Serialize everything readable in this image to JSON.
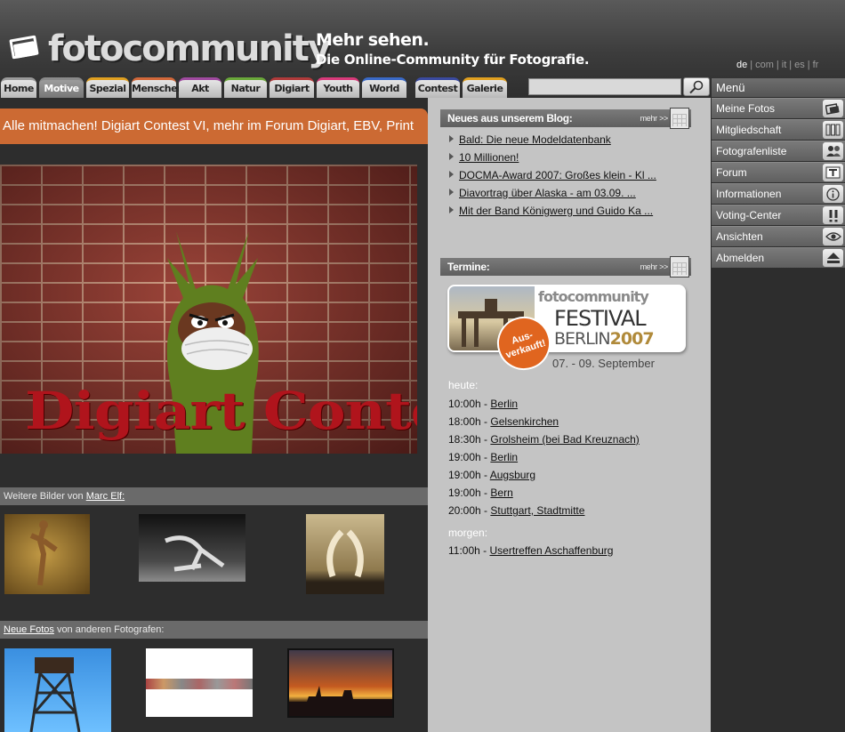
{
  "header": {
    "logo_text": "fotocommunity",
    "tagline_line1": "Mehr sehen.",
    "tagline_line2": "Die Online-Community für Fotografie.",
    "languages": [
      {
        "code": "de",
        "active": true
      },
      {
        "code": "com",
        "active": false
      },
      {
        "code": "it",
        "active": false
      },
      {
        "code": "es",
        "active": false
      },
      {
        "code": "fr",
        "active": false
      }
    ],
    "separator": "|"
  },
  "tabs": [
    {
      "label": "Home",
      "color": "#9a9a9a"
    },
    {
      "label": "Motive",
      "color": "#8a8a8a",
      "active": true
    },
    {
      "label": "Spezial",
      "color": "#e0a020"
    },
    {
      "label": "Menschen",
      "color": "#d2683a"
    },
    {
      "label": "Akt",
      "color": "#a04aa0"
    },
    {
      "label": "Natur",
      "color": "#6aa83a"
    },
    {
      "label": "Digiart",
      "color": "#b03a3a"
    },
    {
      "label": "Youth",
      "color": "#d83a7a"
    },
    {
      "label": "World",
      "color": "#3a6ac8"
    },
    {
      "label": "Contest",
      "color": "#3a4aa0"
    },
    {
      "label": "Galerie",
      "color": "#e0a020"
    }
  ],
  "search": {
    "value": "",
    "placeholder": ""
  },
  "left": {
    "banner_text": "Alle mitmachen! Digiart Contest VI, mehr im Forum Digiart, EBV, Print",
    "contest_image_text": "Digiart Contest VI",
    "more_by_prefix": "Weitere Bilder von",
    "more_by_author": "Marc Elf:",
    "new_photos_link": "Neue Fotos",
    "new_photos_suffix": "von anderen Fotografen:"
  },
  "middle": {
    "blog_title": "Neues aus unserem Blog:",
    "mehr": "mehr >>",
    "blog_items": [
      "Bald: Die neue Modeldatenbank",
      "10 Millionen!",
      "DOCMA-Award 2007: Großes klein - Kl ...",
      "Diavortrag über Alaska - am 03.09. ...",
      "Mit der Band Königwerg und Guido Ka ..."
    ],
    "termine_title": "Termine:",
    "festival": {
      "brand": "fotocommunity",
      "line1": "FESTIVAL",
      "line2_city": "BERLIN",
      "line2_year": "2007",
      "sticker": "Aus-\nverkauft!",
      "dates": "07. - 09. September"
    },
    "today_label": "heute:",
    "today_events": [
      {
        "time": "10:00h -",
        "place": "Berlin"
      },
      {
        "time": "18:00h -",
        "place": "Gelsenkirchen"
      },
      {
        "time": "18:30h -",
        "place": "Grolsheim (bei Bad Kreuznach)"
      },
      {
        "time": "19:00h -",
        "place": "Berlin"
      },
      {
        "time": "19:00h -",
        "place": "Augsburg"
      },
      {
        "time": "19:00h -",
        "place": "Bern"
      },
      {
        "time": "20:00h -",
        "place": "Stuttgart, Stadtmitte"
      }
    ],
    "tomorrow_label": "morgen:",
    "tomorrow_events": [
      {
        "time": "11:00h -",
        "place": "Usertreffen Aschaffenburg"
      }
    ]
  },
  "menu": {
    "title": "Menü",
    "items": [
      {
        "label": "Meine Fotos",
        "icon": "photos-icon"
      },
      {
        "label": "Mitgliedschaft",
        "icon": "membership-icon"
      },
      {
        "label": "Fotografenliste",
        "icon": "users-icon"
      },
      {
        "label": "Forum",
        "icon": "forum-icon"
      },
      {
        "label": "Informationen",
        "icon": "info-icon"
      },
      {
        "label": "Voting-Center",
        "icon": "voting-icon"
      },
      {
        "label": "Ansichten",
        "icon": "eye-icon"
      },
      {
        "label": "Abmelden",
        "icon": "eject-icon"
      }
    ]
  }
}
